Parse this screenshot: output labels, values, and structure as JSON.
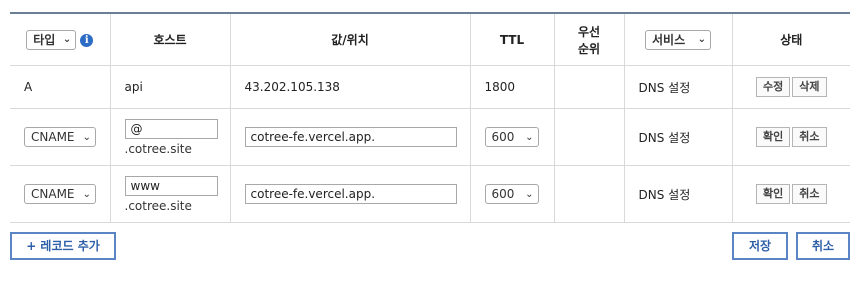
{
  "header": {
    "type_select": "타입",
    "type_info_icon": "i",
    "host": "호스트",
    "value": "값/위치",
    "ttl": "TTL",
    "priority_line1": "우선",
    "priority_line2": "순위",
    "service_select": "서비스",
    "status": "상태"
  },
  "rows": [
    {
      "type": "A",
      "host": "api",
      "value": "43.202.105.138",
      "ttl": "1800",
      "priority": "",
      "service": "DNS 설정",
      "btn1": "수정",
      "btn2": "삭제"
    },
    {
      "type": "CNAME",
      "host_input": "@",
      "host_suffix": ".cotree.site",
      "value_input": "cotree-fe.vercel.app.",
      "ttl_select": "600",
      "priority": "",
      "service": "DNS 설정",
      "btn1": "확인",
      "btn2": "취소"
    },
    {
      "type": "CNAME",
      "host_input": "www",
      "host_suffix": ".cotree.site",
      "value_input": "cotree-fe.vercel.app.",
      "ttl_select": "600",
      "priority": "",
      "service": "DNS 설정",
      "btn1": "확인",
      "btn2": "취소"
    }
  ],
  "footer": {
    "add_record": "+ 레코드 추가",
    "save": "저장",
    "cancel": "취소"
  },
  "colors": {
    "header_top_border": "#6b7f94",
    "button_blue": "#5a84c4",
    "info_blue": "#2d6cc4"
  }
}
